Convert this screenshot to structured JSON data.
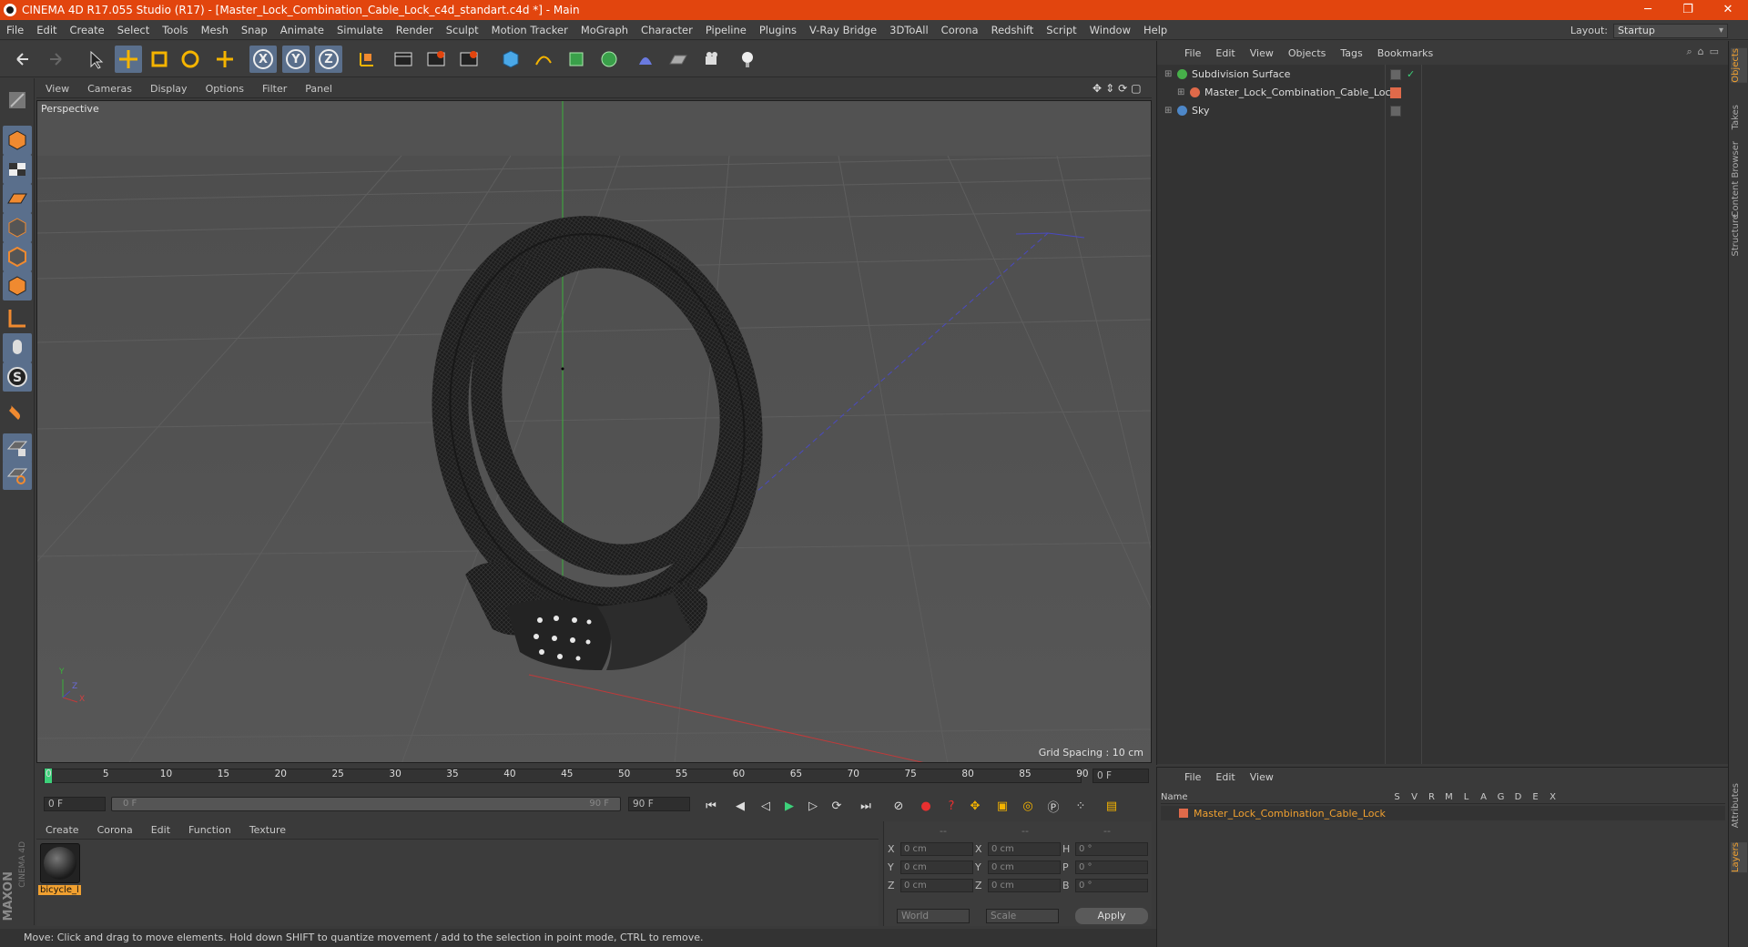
{
  "window": {
    "title": "CINEMA 4D R17.055 Studio (R17) - [Master_Lock_Combination_Cable_Lock_c4d_standart.c4d *] - Main",
    "minimize": "─",
    "restore": "❐",
    "close": "✕",
    "app_icon": "cinema4d-logo-icon"
  },
  "menubar": {
    "items": [
      "File",
      "Edit",
      "Create",
      "Select",
      "Tools",
      "Mesh",
      "Snap",
      "Animate",
      "Simulate",
      "Render",
      "Sculpt",
      "Motion Tracker",
      "MoGraph",
      "Character",
      "Pipeline",
      "Plugins",
      "V-Ray Bridge",
      "3DToAll",
      "Corona",
      "Redshift",
      "Script",
      "Window",
      "Help"
    ],
    "layout_label": "Layout:",
    "layout_value": "Startup"
  },
  "toolbar": {
    "icons": [
      "undo-icon",
      "redo-icon",
      "live-selection-icon",
      "move-icon",
      "scale-icon",
      "rotate-icon",
      "recent-tool-icon",
      "x-axis-icon",
      "y-axis-icon",
      "z-axis-icon",
      "coordinate-system-icon",
      "render-view-icon",
      "render-picture-viewer-icon",
      "edit-render-settings-icon",
      "cube-icon",
      "pen-spline-icon",
      "subdivision-nurbs-icon",
      "array-icon",
      "deformer-icon",
      "floor-icon",
      "camera-icon",
      "light-icon"
    ],
    "axis_labels": [
      "X",
      "Y",
      "Z"
    ]
  },
  "left_tools": {
    "icons": [
      "make-editable-icon",
      "model-mode-icon",
      "texture-mode-icon",
      "workplane-icon",
      "points-mode-icon",
      "edges-mode-icon",
      "polygons-mode-icon",
      "axis-mode-icon",
      "tweak-mode-icon",
      "snap-s-icon",
      "magnet-icon",
      "locked-workplane-icon",
      "solo-icon"
    ]
  },
  "viewport": {
    "menu": [
      "View",
      "Cameras",
      "Display",
      "Options",
      "Filter",
      "Panel"
    ],
    "camera": "Perspective",
    "grid_spacing": "Grid Spacing : 10 cm",
    "nav_icons": [
      "move-view-icon",
      "zoom-view-icon",
      "rotate-view-icon",
      "maximize-view-icon"
    ],
    "axis": {
      "y": "Y",
      "z": "Z",
      "x": "X"
    }
  },
  "timeline": {
    "ticks": [
      "0",
      "5",
      "10",
      "15",
      "20",
      "25",
      "30",
      "35",
      "40",
      "45",
      "50",
      "55",
      "60",
      "65",
      "70",
      "75",
      "80",
      "85",
      "90"
    ],
    "current_frame": "0 F"
  },
  "transport": {
    "start_field": "0 F",
    "range_start": "0 F",
    "range_end": "90 F",
    "end_field": "90 F",
    "icons": [
      "goto-start-icon",
      "prev-key-icon",
      "prev-frame-icon",
      "play-icon",
      "next-frame-icon",
      "loop-icon",
      "goto-end-icon",
      "motion-record-icon",
      "record-icon",
      "autokey-icon",
      "move-key-icon",
      "scale-key-icon",
      "rotate-key-icon",
      "param-key-icon",
      "point-level-icon",
      "timeline-icon"
    ]
  },
  "material": {
    "menu": [
      "Create",
      "Corona",
      "Edit",
      "Function",
      "Texture"
    ],
    "items": [
      {
        "name": "bicycle_l"
      }
    ]
  },
  "coordinates": {
    "headers": [
      "--",
      "--",
      "--"
    ],
    "rows": [
      {
        "a": "X",
        "av": "0 cm",
        "b": "X",
        "bv": "0 cm",
        "c": "H",
        "cv": "0 °"
      },
      {
        "a": "Y",
        "av": "0 cm",
        "b": "Y",
        "bv": "0 cm",
        "c": "P",
        "cv": "0 °"
      },
      {
        "a": "Z",
        "av": "0 cm",
        "b": "Z",
        "bv": "0 cm",
        "c": "B",
        "cv": "0 °"
      }
    ],
    "mode": "World",
    "mode2": "Scale",
    "apply": "Apply"
  },
  "status": "Move: Click and drag to move elements. Hold down SHIFT to quantize movement / add to the selection in point mode, CTRL to remove.",
  "objects_panel": {
    "menu": [
      "File",
      "Edit",
      "View",
      "Objects",
      "Tags",
      "Bookmarks"
    ],
    "items": [
      {
        "name": "Subdivision Surface",
        "color": "#47b04a"
      },
      {
        "name": "Master_Lock_Combination_Cable_Lock",
        "color": "#e06a4a"
      },
      {
        "name": "Sky",
        "color": "#4d87c8"
      }
    ]
  },
  "layers_panel": {
    "menu": [
      "File",
      "Edit",
      "View"
    ],
    "columns": [
      "Name",
      "S",
      "V",
      "R",
      "M",
      "L",
      "A",
      "G",
      "D",
      "E",
      "X"
    ],
    "items": [
      {
        "name": "Master_Lock_Combination_Cable_Lock",
        "color": "#e06a4a"
      }
    ]
  },
  "right_tabs": [
    "Objects",
    "Takes",
    "Content Browser",
    "Structure",
    "Attributes",
    "Layers"
  ],
  "brand": {
    "maxon": "MAXON",
    "c4d": "CINEMA 4D"
  },
  "colors": {
    "accent": "#e2450e",
    "selected": "#5a6f8c",
    "orange_text": "#f0a030"
  }
}
